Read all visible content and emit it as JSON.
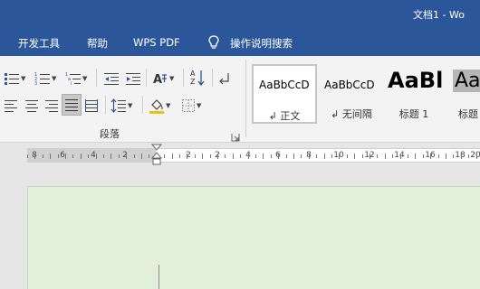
{
  "window": {
    "title": "文档1  -  Wo"
  },
  "menu": {
    "items": [
      "开发工具",
      "帮助",
      "WPS PDF"
    ],
    "tell_me": "操作说明搜索",
    "tell_me_icon": "lightbulb-icon"
  },
  "ribbon": {
    "paragraph_group": {
      "label": "段落",
      "row1_icons": [
        "bullets-icon",
        "numbering-icon",
        "multilevel-list-icon",
        "decrease-indent-icon",
        "increase-indent-icon",
        "chinese-layout-icon",
        "sort-icon",
        "show-marks-icon"
      ],
      "row2_icons": [
        "align-left-icon",
        "align-center-icon",
        "align-right-icon",
        "justify-icon",
        "distributed-icon",
        "line-spacing-icon",
        "shading-icon",
        "borders-icon"
      ],
      "active_alignment": "justify"
    },
    "styles": [
      {
        "sample": "AaBbCcD",
        "name": "正文",
        "marker": "↲",
        "selected": true
      },
      {
        "sample": "AaBbCcD",
        "name": "无间隔",
        "marker": "↲",
        "selected": false
      },
      {
        "sample": "AaBl",
        "name": "标题 1",
        "marker": "",
        "selected": false
      },
      {
        "sample": "AaB",
        "name": "标题",
        "marker": "",
        "selected": false
      }
    ]
  },
  "ruler": {
    "labels": [
      "8",
      "6",
      "4",
      "2",
      "2",
      "2",
      "4",
      "6",
      "8",
      "10",
      "12",
      "14",
      "16",
      "18",
      "20"
    ]
  },
  "colors": {
    "title_bar": "#2b579a",
    "ribbon_bg": "#f3f3f3",
    "page_bg": "#e2efda",
    "workspace_bg": "#e6e6e6"
  }
}
